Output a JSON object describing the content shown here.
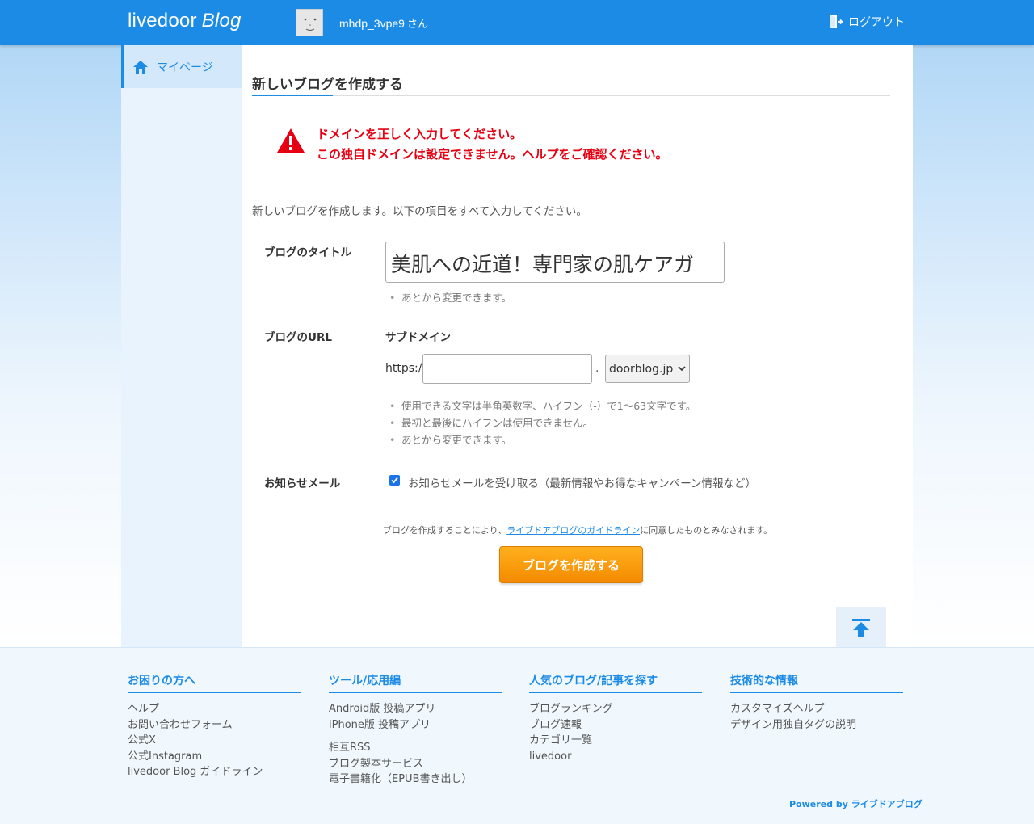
{
  "header": {
    "logo_main": "livedoor",
    "logo_blog": "Blog",
    "username": "mhdp_3vpe9",
    "username_suffix": "さん",
    "logout_label": "ログアウト"
  },
  "sidebar": {
    "items": [
      {
        "label": "マイページ"
      }
    ]
  },
  "main": {
    "title": "新しいブログを作成する",
    "errors": [
      "ドメインを正しく入力してください。",
      "この独自ドメインは設定できません。ヘルプをご確認ください。"
    ],
    "intro": "新しいブログを作成します。以下の項目をすべて入力してください。",
    "blog_title_label": "ブログのタイトル",
    "blog_title_value": "美肌への近道！専門家の肌ケアガ",
    "blog_title_note": "あとから変更できます。",
    "blog_url_label": "ブログのURL",
    "subdomain_label": "サブドメイン",
    "url_prefix": "https://",
    "url_dot": ".",
    "subdomain_value": "",
    "domain_selected": "doorblog.jp",
    "url_notes": [
      "使用できる文字は半角英数字、ハイフン（-）で1～63文字です。",
      "最初と最後にハイフンは使用できません。",
      "あとから変更できます。"
    ],
    "newsletter_label": "お知らせメール",
    "newsletter_checkbox_label": "お知らせメールを受け取る（最新情報やお得なキャンペーン情報など）",
    "newsletter_checked": true,
    "agree_prefix": "ブログを作成することにより、",
    "agree_link": "ライブドアブログのガイドライン",
    "agree_suffix": "に同意したものとみなされます。",
    "submit_label": "ブログを作成する"
  },
  "footer": {
    "columns": [
      {
        "title": "お困りの方へ",
        "links": [
          "ヘルプ",
          "お問い合わせフォーム",
          "公式X",
          "公式Instagram",
          "livedoor Blog ガイドライン"
        ]
      },
      {
        "title": "ツール/応用編",
        "links": [
          "Android版 投稿アプリ",
          "iPhone版 投稿アプリ",
          "相互RSS",
          "ブログ製本サービス",
          "電子書籍化（EPUB書き出し）"
        ]
      },
      {
        "title": "人気のブログ/記事を探す",
        "links": [
          "ブログランキング",
          "ブログ速報",
          "カテゴリ一覧",
          "livedoor"
        ]
      },
      {
        "title": "技術的な情報",
        "links": [
          "カスタマイズヘルプ",
          "デザイン用独自タグの説明"
        ]
      }
    ],
    "powered_prefix": "Powered by",
    "powered_name": "ライブドアブログ"
  },
  "colors": {
    "brand": "#1c8be6",
    "error": "#e60012",
    "submit": "#f48a00"
  }
}
